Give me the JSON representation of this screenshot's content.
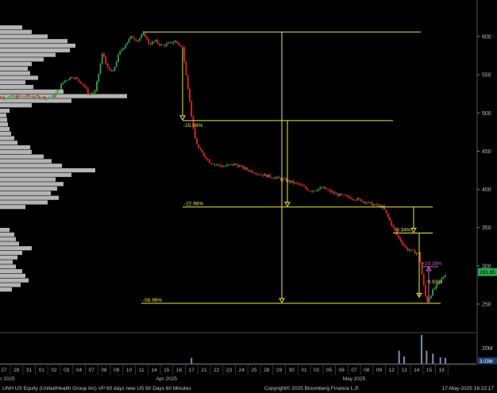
{
  "chart_data": {
    "type": "candlestick",
    "ticker_line": "UNH US Equity (UnitedHealth Group Inc) VP 60 days new US 60 Days 60 Minutes",
    "copyright": "Copyright© 2025 Bloomberg Finance L.P.",
    "timestamp": "17-May-2025 16:22:17",
    "y_ticks": [
      250,
      300,
      350,
      400,
      450,
      500,
      550,
      600
    ],
    "ylim": [
      220,
      618
    ],
    "volume_tick_label": "20M",
    "last_price_label": "291.85",
    "last_volume_label": "3.03M",
    "x_labels": [
      {
        "label": "27",
        "day": 0
      },
      {
        "label": "28",
        "day": 1
      },
      {
        "label": "31",
        "day": 2
      },
      {
        "label": "01",
        "day": 3
      },
      {
        "label": "02",
        "day": 4
      },
      {
        "label": "03",
        "day": 5
      },
      {
        "label": "04",
        "day": 6
      },
      {
        "label": "07",
        "day": 7
      },
      {
        "label": "08",
        "day": 8
      },
      {
        "label": "09",
        "day": 9
      },
      {
        "label": "10",
        "day": 10
      },
      {
        "label": "11",
        "day": 11
      },
      {
        "label": "14",
        "day": 12
      },
      {
        "label": "15",
        "day": 13
      },
      {
        "label": "16",
        "day": 14
      },
      {
        "label": "17",
        "day": 15
      },
      {
        "label": "21",
        "day": 16
      },
      {
        "label": "22",
        "day": 17
      },
      {
        "label": "23",
        "day": 18
      },
      {
        "label": "24",
        "day": 19
      },
      {
        "label": "25",
        "day": 20
      },
      {
        "label": "28",
        "day": 21
      },
      {
        "label": "29",
        "day": 22
      },
      {
        "label": "30",
        "day": 23
      },
      {
        "label": "01",
        "day": 24
      },
      {
        "label": "02",
        "day": 25
      },
      {
        "label": "05",
        "day": 26
      },
      {
        "label": "06",
        "day": 27
      },
      {
        "label": "07",
        "day": 28
      },
      {
        "label": "08",
        "day": 29
      },
      {
        "label": "09",
        "day": 30
      },
      {
        "label": "12",
        "day": 31
      },
      {
        "label": "13",
        "day": 32
      },
      {
        "label": "14",
        "day": 33
      },
      {
        "label": "15",
        "day": 34
      },
      {
        "label": "16",
        "day": 35
      }
    ],
    "month_labels": [
      {
        "label": "Mar 2025",
        "day": 0
      },
      {
        "label": "Apr 2025",
        "day": 13
      },
      {
        "label": "May 2025",
        "day": 28
      }
    ],
    "price_path": [
      {
        "day": -1.0,
        "price": 520
      },
      {
        "day": 0.5,
        "price": 521
      },
      {
        "day": 2.0,
        "price": 522
      },
      {
        "day": 3.5,
        "price": 520
      },
      {
        "day": 4.0,
        "price": 522
      },
      {
        "day": 4.8,
        "price": 542
      },
      {
        "day": 5.5,
        "price": 548
      },
      {
        "day": 6.3,
        "price": 538
      },
      {
        "day": 6.8,
        "price": 524
      },
      {
        "day": 7.3,
        "price": 528
      },
      {
        "day": 7.9,
        "price": 580
      },
      {
        "day": 8.3,
        "price": 557
      },
      {
        "day": 8.7,
        "price": 553
      },
      {
        "day": 9.2,
        "price": 578
      },
      {
        "day": 9.8,
        "price": 592
      },
      {
        "day": 10.2,
        "price": 600
      },
      {
        "day": 10.7,
        "price": 595
      },
      {
        "day": 11.2,
        "price": 604
      },
      {
        "day": 11.6,
        "price": 590
      },
      {
        "day": 12.1,
        "price": 594
      },
      {
        "day": 12.6,
        "price": 588
      },
      {
        "day": 13.1,
        "price": 590
      },
      {
        "day": 13.7,
        "price": 594
      },
      {
        "day": 14.3,
        "price": 585
      },
      {
        "day": 14.9,
        "price": 510
      },
      {
        "day": 15.2,
        "price": 470
      },
      {
        "day": 15.6,
        "price": 452
      },
      {
        "day": 16.5,
        "price": 435
      },
      {
        "day": 17.5,
        "price": 430
      },
      {
        "day": 18.5,
        "price": 433
      },
      {
        "day": 19.4,
        "price": 426
      },
      {
        "day": 20.5,
        "price": 420
      },
      {
        "day": 21.5,
        "price": 416
      },
      {
        "day": 22.5,
        "price": 412
      },
      {
        "day": 23.5,
        "price": 407
      },
      {
        "day": 24.5,
        "price": 398
      },
      {
        "day": 25.5,
        "price": 402
      },
      {
        "day": 26.5,
        "price": 394
      },
      {
        "day": 27.5,
        "price": 390
      },
      {
        "day": 28.5,
        "price": 386
      },
      {
        "day": 29.5,
        "price": 380
      },
      {
        "day": 30.3,
        "price": 377
      },
      {
        "day": 31.5,
        "price": 338
      },
      {
        "day": 32.2,
        "price": 322
      },
      {
        "day": 32.8,
        "price": 318
      },
      {
        "day": 33.2,
        "price": 316
      },
      {
        "day": 33.5,
        "price": 280
      },
      {
        "day": 33.8,
        "price": 252
      },
      {
        "day": 34.3,
        "price": 268
      },
      {
        "day": 34.8,
        "price": 278
      },
      {
        "day": 35.4,
        "price": 291.85
      }
    ],
    "volume_profile": [
      {
        "price": 612,
        "length": 28
      },
      {
        "price": 606,
        "length": 40
      },
      {
        "price": 600,
        "length": 60
      },
      {
        "price": 594,
        "length": 85
      },
      {
        "price": 588,
        "length": 95
      },
      {
        "price": 582,
        "length": 88
      },
      {
        "price": 576,
        "length": 70
      },
      {
        "price": 570,
        "length": 55
      },
      {
        "price": 564,
        "length": 40
      },
      {
        "price": 558,
        "length": 35
      },
      {
        "price": 552,
        "length": 38
      },
      {
        "price": 546,
        "length": 48
      },
      {
        "price": 540,
        "length": 32
      },
      {
        "price": 534,
        "length": 42
      },
      {
        "price": 528,
        "length": 80
      },
      {
        "price": 522,
        "length": 160
      },
      {
        "price": 516,
        "length": 90
      },
      {
        "price": 510,
        "length": 40
      },
      {
        "price": 503,
        "length": 12
      },
      {
        "price": 497,
        "length": 8
      },
      {
        "price": 491,
        "length": 9
      },
      {
        "price": 485,
        "length": 10
      },
      {
        "price": 479,
        "length": 12
      },
      {
        "price": 473,
        "length": 14
      },
      {
        "price": 467,
        "length": 18
      },
      {
        "price": 461,
        "length": 22
      },
      {
        "price": 455,
        "length": 38
      },
      {
        "price": 449,
        "length": 40
      },
      {
        "price": 443,
        "length": 55
      },
      {
        "price": 437,
        "length": 65
      },
      {
        "price": 431,
        "length": 78
      },
      {
        "price": 425,
        "length": 120
      },
      {
        "price": 419,
        "length": 90
      },
      {
        "price": 413,
        "length": 70
      },
      {
        "price": 407,
        "length": 80
      },
      {
        "price": 401,
        "length": 72
      },
      {
        "price": 395,
        "length": 64
      },
      {
        "price": 389,
        "length": 74
      },
      {
        "price": 383,
        "length": 60
      },
      {
        "price": 377,
        "length": 32
      },
      {
        "price": 347,
        "length": 12
      },
      {
        "price": 341,
        "length": 18
      },
      {
        "price": 335,
        "length": 20
      },
      {
        "price": 329,
        "length": 24
      },
      {
        "price": 323,
        "length": 40
      },
      {
        "price": 317,
        "length": 28
      },
      {
        "price": 311,
        "length": 22
      },
      {
        "price": 305,
        "length": 16
      },
      {
        "price": 299,
        "length": 20
      },
      {
        "price": 293,
        "length": 28
      },
      {
        "price": 287,
        "length": 32
      },
      {
        "price": 281,
        "length": 36
      },
      {
        "price": 275,
        "length": 26
      },
      {
        "price": 269,
        "length": 15
      }
    ],
    "volume_bars": [
      {
        "day": 33.4,
        "value": 1.0
      },
      {
        "day": 33.8,
        "value": 0.45
      },
      {
        "day": 34.3,
        "value": 0.35
      },
      {
        "day": 34.9,
        "value": 0.22
      },
      {
        "day": 35.3,
        "value": 0.2
      },
      {
        "day": 31.6,
        "value": 0.45
      },
      {
        "day": 32.0,
        "value": 0.25
      },
      {
        "day": 15.0,
        "value": 0.2
      }
    ],
    "annotations": {
      "levels": [
        {
          "name": "top",
          "price": 606,
          "label": ""
        },
        {
          "name": "first-drop",
          "price": 490,
          "label": "-15.98%"
        },
        {
          "name": "second-drop",
          "price": 377,
          "label": "-22.96%"
        },
        {
          "name": "third-drop",
          "price": 343,
          "label": "-9.34%"
        },
        {
          "name": "low",
          "price": 251,
          "label": "-58.96%"
        },
        {
          "name": "bounce",
          "price": 299,
          "label": "+19.38%"
        }
      ],
      "extra_labels": [
        {
          "text": "-9.93%",
          "day": 34.0,
          "price": 277
        }
      ]
    },
    "colors": {
      "up": "#2aa84a",
      "down": "#e0262a",
      "annotation": "#e8e84a",
      "bounce": "#c060c0",
      "profile": "#d4d4d4",
      "last_price_box": "#2aa84a",
      "volume": "#7a90b0"
    }
  }
}
